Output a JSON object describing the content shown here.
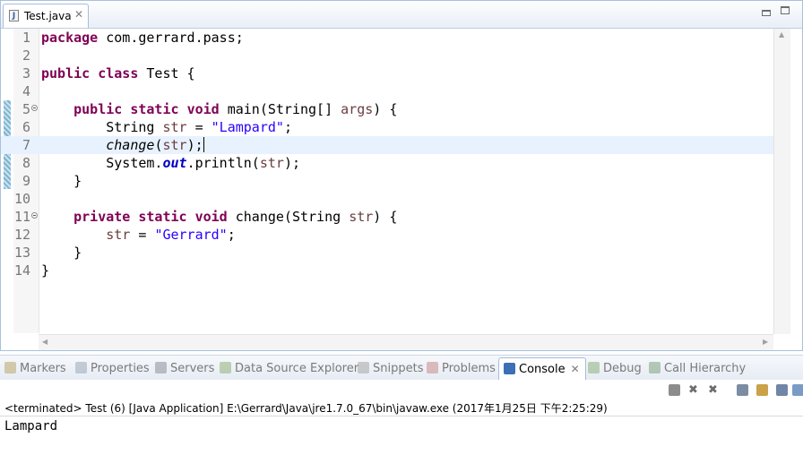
{
  "editor": {
    "tab_label": "Test.java",
    "tab_icon": "java-file-icon",
    "tab_close": "✕",
    "lines": [
      {
        "n": "1",
        "segments": [
          {
            "t": "package",
            "c": "kw"
          },
          {
            "t": " com.gerrard.pass;",
            "c": ""
          }
        ]
      },
      {
        "n": "2",
        "segments": []
      },
      {
        "n": "3",
        "segments": [
          {
            "t": "public",
            "c": "kw"
          },
          {
            "t": " ",
            "c": ""
          },
          {
            "t": "class",
            "c": "kw"
          },
          {
            "t": " Test {",
            "c": ""
          }
        ]
      },
      {
        "n": "4",
        "segments": []
      },
      {
        "n": "5",
        "fold": true,
        "segments": [
          {
            "t": "    ",
            "c": ""
          },
          {
            "t": "public",
            "c": "kw"
          },
          {
            "t": " ",
            "c": ""
          },
          {
            "t": "static",
            "c": "kw"
          },
          {
            "t": " ",
            "c": ""
          },
          {
            "t": "void",
            "c": "kw"
          },
          {
            "t": " main(String[] ",
            "c": ""
          },
          {
            "t": "args",
            "c": "param"
          },
          {
            "t": ") {",
            "c": ""
          }
        ]
      },
      {
        "n": "6",
        "segments": [
          {
            "t": "        String ",
            "c": ""
          },
          {
            "t": "str",
            "c": "param"
          },
          {
            "t": " = ",
            "c": ""
          },
          {
            "t": "\"Lampard\"",
            "c": "str"
          },
          {
            "t": ";",
            "c": ""
          }
        ]
      },
      {
        "n": "7",
        "current": true,
        "segments": [
          {
            "t": "        ",
            "c": ""
          },
          {
            "t": "change",
            "c": "it"
          },
          {
            "t": "(",
            "c": ""
          },
          {
            "t": "str",
            "c": "param"
          },
          {
            "t": ");",
            "c": ""
          }
        ]
      },
      {
        "n": "8",
        "segments": [
          {
            "t": "        System.",
            "c": ""
          },
          {
            "t": "out",
            "c": "field"
          },
          {
            "t": ".println(",
            "c": ""
          },
          {
            "t": "str",
            "c": "param"
          },
          {
            "t": ");",
            "c": ""
          }
        ]
      },
      {
        "n": "9",
        "segments": [
          {
            "t": "    }",
            "c": ""
          }
        ]
      },
      {
        "n": "10",
        "segments": []
      },
      {
        "n": "11",
        "fold": true,
        "segments": [
          {
            "t": "    ",
            "c": ""
          },
          {
            "t": "private",
            "c": "kw"
          },
          {
            "t": " ",
            "c": ""
          },
          {
            "t": "static",
            "c": "kw"
          },
          {
            "t": " ",
            "c": ""
          },
          {
            "t": "void",
            "c": "kw"
          },
          {
            "t": " change(String ",
            "c": ""
          },
          {
            "t": "str",
            "c": "param"
          },
          {
            "t": ") {",
            "c": ""
          }
        ]
      },
      {
        "n": "12",
        "segments": [
          {
            "t": "        ",
            "c": ""
          },
          {
            "t": "str",
            "c": "param"
          },
          {
            "t": " = ",
            "c": ""
          },
          {
            "t": "\"Gerrard\"",
            "c": "str"
          },
          {
            "t": ";",
            "c": ""
          }
        ]
      },
      {
        "n": "13",
        "segments": [
          {
            "t": "    }",
            "c": ""
          }
        ]
      },
      {
        "n": "14",
        "segments": [
          {
            "t": "}",
            "c": ""
          }
        ]
      }
    ]
  },
  "views": {
    "tabs": [
      {
        "label": "Markers",
        "icon": "markers-icon",
        "color": "#b9a66b"
      },
      {
        "label": "Properties",
        "icon": "properties-icon",
        "color": "#9aa8b8"
      },
      {
        "label": "Servers",
        "icon": "servers-icon",
        "color": "#8a8f99"
      },
      {
        "label": "Data Source Explorer",
        "icon": "data-source-icon",
        "color": "#8fb07a"
      },
      {
        "label": "Snippets",
        "icon": "snippets-icon",
        "color": "#a6a6a6"
      },
      {
        "label": "Problems",
        "icon": "problems-icon",
        "color": "#c98a8a"
      },
      {
        "label": "Console",
        "icon": "console-icon",
        "color": "#3c6fb5",
        "active": true
      },
      {
        "label": "Debug",
        "icon": "debug-icon",
        "color": "#8ab07e"
      },
      {
        "label": "Call Hierarchy",
        "icon": "call-hierarchy-icon",
        "color": "#7fa37f"
      }
    ],
    "close_glyph": "✕"
  },
  "console": {
    "header": "<terminated> Test (6) [Java Application] E:\\Gerrard\\Java\\jre1.7.0_67\\bin\\javaw.exe (2017年1月25日 下午2:25:29)",
    "output": "Lampard",
    "toolbar": [
      "terminate-icon",
      "remove-launch-icon",
      "remove-all-terminated-icon",
      "clear-console-icon",
      "scroll-lock-icon",
      "pin-console-icon",
      "display-selected-console-icon"
    ]
  }
}
